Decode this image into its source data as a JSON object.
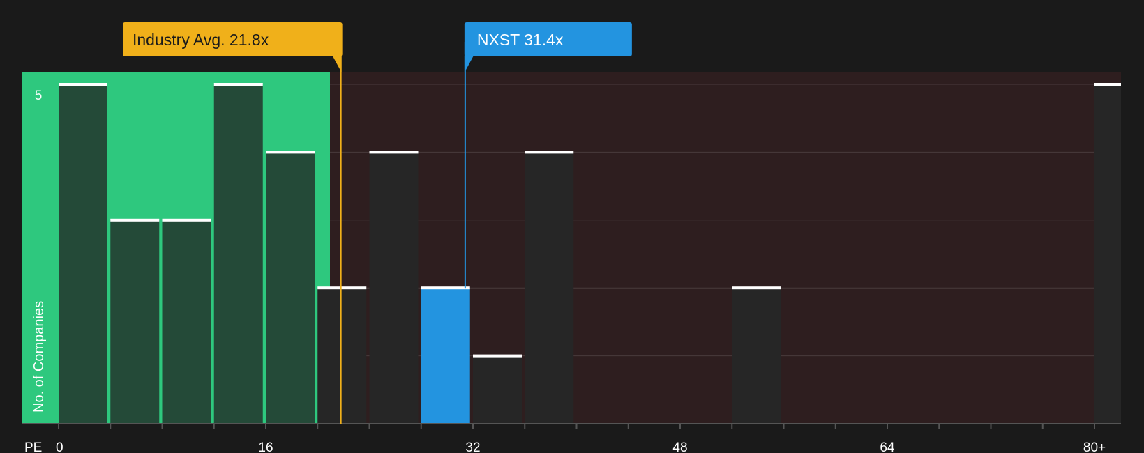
{
  "chart_data": {
    "type": "bar",
    "title": "",
    "xlabel": "PE",
    "ylabel": "No. of Companies",
    "x_ticks": [
      "0",
      "16",
      "32",
      "48",
      "64",
      "80+"
    ],
    "y_ticks": [
      "5"
    ],
    "ylim": [
      0,
      5
    ],
    "bin_width": 4,
    "bins": [
      {
        "x_start": 0,
        "value": 5
      },
      {
        "x_start": 4,
        "value": 3
      },
      {
        "x_start": 8,
        "value": 3
      },
      {
        "x_start": 12,
        "value": 5
      },
      {
        "x_start": 16,
        "value": 4
      },
      {
        "x_start": 20,
        "value": 2
      },
      {
        "x_start": 24,
        "value": 4
      },
      {
        "x_start": 28,
        "value": 2,
        "highlight": true
      },
      {
        "x_start": 32,
        "value": 1
      },
      {
        "x_start": 36,
        "value": 4
      },
      {
        "x_start": 52,
        "value": 2
      },
      {
        "x_start": 80,
        "value": 5
      }
    ],
    "annotations": {
      "industry_avg": {
        "label": "Industry Avg. 21.8x",
        "value": 21.8
      },
      "company": {
        "label": "NXST 31.4x",
        "value": 31.4
      }
    },
    "colors": {
      "background": "#1a1a1a",
      "fair_region": "#2ec87e",
      "expensive_region": "#2e1e1f",
      "bar": "#262626",
      "bar_in_fair": "#244a38",
      "highlight_bar": "#2394e0",
      "industry_line": "#f0b01a",
      "company_line": "#2394e0",
      "cap": "#ffffff"
    }
  }
}
